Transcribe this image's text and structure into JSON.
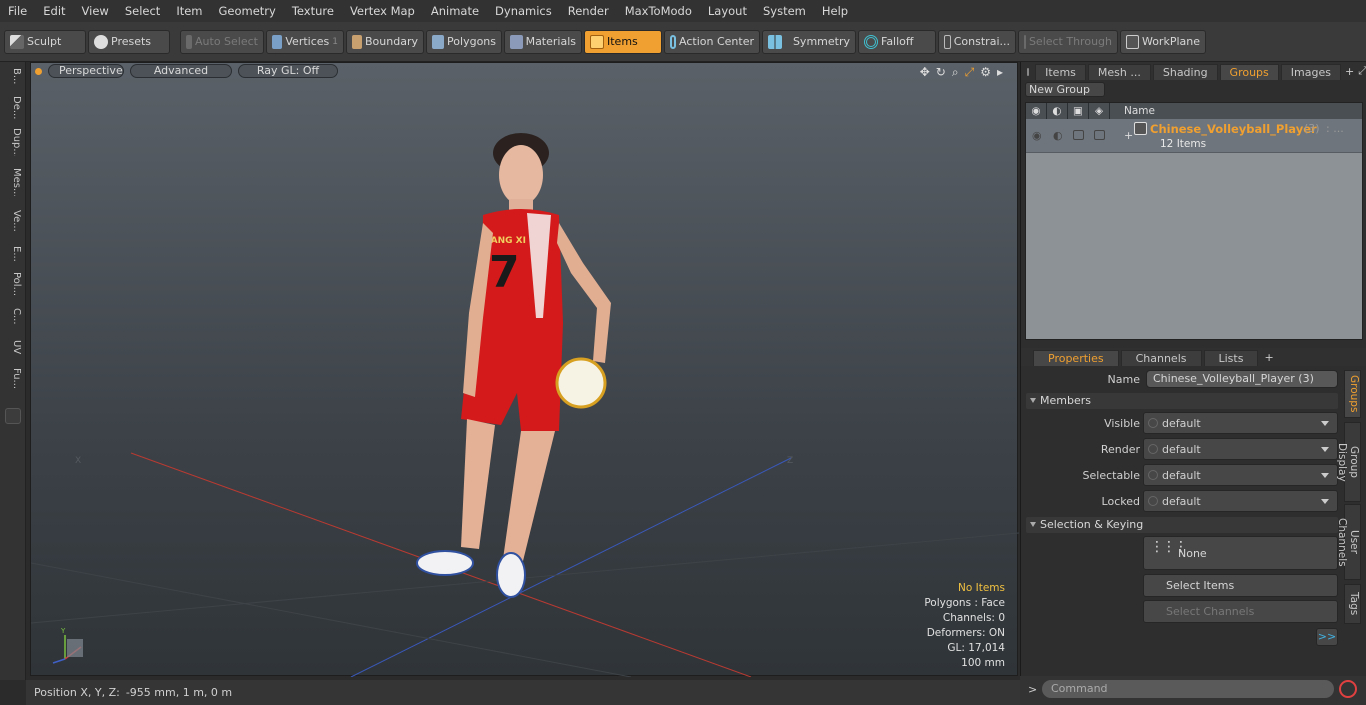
{
  "menu": [
    "File",
    "Edit",
    "View",
    "Select",
    "Item",
    "Geometry",
    "Texture",
    "Vertex Map",
    "Animate",
    "Dynamics",
    "Render",
    "MaxToModo",
    "Layout",
    "System",
    "Help"
  ],
  "toolbar": {
    "sculpt": "Sculpt",
    "presets": "Presets",
    "auto_select": "Auto Select",
    "vertices": "Vertices",
    "vertices_count": "1",
    "boundary": "Boundary",
    "polygons": "Polygons",
    "materials": "Materials",
    "items": "Items",
    "action_center": "Action Center",
    "symmetry": "Symmetry",
    "falloff": "Falloff",
    "constraints": "Constrai...",
    "select_through": "Select Through",
    "workplane": "WorkPlane"
  },
  "left_tabs": [
    "B...",
    "De...",
    "Dup...",
    "Mes...",
    "Ve...",
    "E...",
    "Pol...",
    "C...",
    "UV",
    "Fu..."
  ],
  "viewport": {
    "perspective": "Perspective",
    "advanced": "Advanced",
    "raygl": "Ray GL: Off",
    "stats": {
      "no_items": "No Items",
      "polygons": "Polygons : Face",
      "channels": "Channels: 0",
      "deformers": "Deformers: ON",
      "gl": "GL: 17,014",
      "scale": "100 mm"
    },
    "jersey_number": "7",
    "jersey_name": "YANG XI",
    "axis_y": "Y",
    "axis_x": "X",
    "axis_z": "Z"
  },
  "status": {
    "label": "Position X, Y, Z:",
    "value": "-955 mm, 1 m, 0 m"
  },
  "right_top_tabs": [
    "Items",
    "Mesh ...",
    "Shading",
    "Groups",
    "Images"
  ],
  "groups": {
    "new_group": "New Group",
    "name_col": "Name",
    "row": {
      "name": "Chinese_Volleyball_Player",
      "count": "(3)",
      "extra": ": ...",
      "items": "12 Items"
    }
  },
  "props_tabs": [
    "Properties",
    "Channels",
    "Lists"
  ],
  "props": {
    "name_label": "Name",
    "name_value": "Chinese_Volleyball_Player (3)",
    "members": "Members",
    "fields": [
      {
        "label": "Visible",
        "value": "default"
      },
      {
        "label": "Render",
        "value": "default"
      },
      {
        "label": "Selectable",
        "value": "default"
      },
      {
        "label": "Locked",
        "value": "default"
      }
    ],
    "selection_keying": "Selection & Keying",
    "none": "None",
    "select_items": "Select Items",
    "select_channels": "Select Channels",
    "more": ">>"
  },
  "side_tabs": [
    "Groups",
    "Group Display",
    "User Channels",
    "Tags"
  ],
  "command": {
    "prompt": ">",
    "placeholder": "Command"
  },
  "colors": {
    "accent": "#f0a030",
    "jersey": "#d41a1a"
  }
}
